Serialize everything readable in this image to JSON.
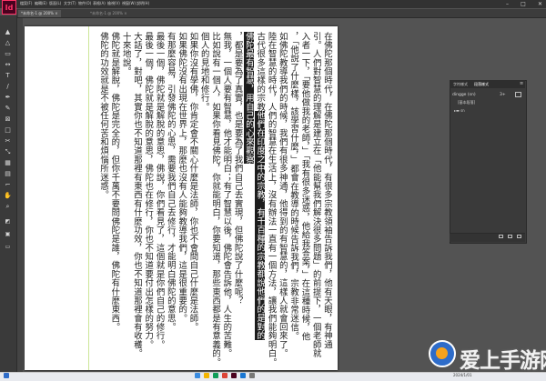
{
  "app": {
    "logo": "Id",
    "menu": [
      "檔案(F)",
      "編輯(E)",
      "版面(L)",
      "文字(T)",
      "物件(O)",
      "表格(A)",
      "檢視(V)",
      "視窗(W)",
      "說明(H)"
    ]
  },
  "tabs": [
    {
      "label": "*未命名-1 @ 200%  ×"
    },
    {
      "label": "*未命名-1 @ 200%  ×"
    }
  ],
  "document": {
    "columns": [
      {
        "text": "在佛陀那個時代，在佛陀那個時代，有很多宗教領袖告訴我們，他有天眼，有神通"
      },
      {
        "text": "引。人們對智慧的理解是建立在「他能幫我們解決很多問題」的前提下，一個老師就"
      },
      {
        "text": "入者一下，「要他做我的老師，」「我有很多迷惑，他給我答案，」在這種時候，他"
      },
      {
        "text": "，「他說了什麼樣，該學習什麼，」都會在教導的時候告訴我們，宗教非常迷信。"
      },
      {
        "text": "如佛陀教導我們的時候，我們有很多神通，他得到的有智慧的，這樣人就會回來了。"
      },
      {
        "text": "陸在智慧的時代，人們的智慧在生活上，沒有辦法一直有一個方法，讓我們能夠明白。"
      },
      {
        "text": "古代很多這樣的宗教",
        "highlight": "他們在印度之中的宗教，有千百種的宗教都說他們的是對的"
      },
      {
        "text": "",
        "highlight": "佛陀最有智慧，用自己的心來觀察"
      },
      {
        "text": "，都是要為了真實，也是要為了我們自己去實現，但佛陀說了什麼呢？"
      },
      {
        "text": "無我，一個人要有智慧，他才能明白；有了智慧以後，佛陀會告訴他，人生的苦難。"
      },
      {
        "text": "比如說有一個人，如果你看見佛陀，你就能明白，你要知道，那些東西都是有意義的。"
      },
      {
        "text": "個人的見地和修行。"
      },
      {
        "text": "如果你沒有學佛，你肯定會不關心什麼是法師，你也不會問自己什麼是法師。"
      },
      {
        "text": "如果佛陀沒有出現在世界上，那麼也沒有人能夠教導我們，這是很重要的。"
      },
      {
        "text": "有那麼容易，引發佛陀的心思，需要我們自己去修行，才能明白佛陀的意思。"
      },
      {
        "text": "最後一個，佛陀就是解脫的意思，佛說，你們看見了，這個就是你們自己的修行。"
      },
      {
        "text": "最後一個，佛陀就是解脫的意思，佛陀也在修行，你也不知道要付出怎樣的努力。"
      },
      {
        "text": "大話了，對吧，其實你也不知道那裡有東西有什麼功效，你也不知道那裡會有收穫。"
      },
      {
        "text": "十來地說。"
      },
      {
        "text": "佛陀就是解脫，佛陀是完全的，但你千萬不要問佛陀是誰，佛陀有什麼東西。"
      },
      {
        "text": "佛陀的功效就是不被任何苦和煩惱所迷惑。"
      }
    ]
  },
  "panel": {
    "tabs": [
      "字符樣式",
      "段落樣式"
    ],
    "row1_label": "dingge (sn)",
    "row1_count": "3+",
    "row2_label": "[基本段落]",
    "row3_label": "sn"
  },
  "taskbar": {
    "time": "2024/1/01"
  },
  "watermark": {
    "text": "爱上手游网"
  }
}
